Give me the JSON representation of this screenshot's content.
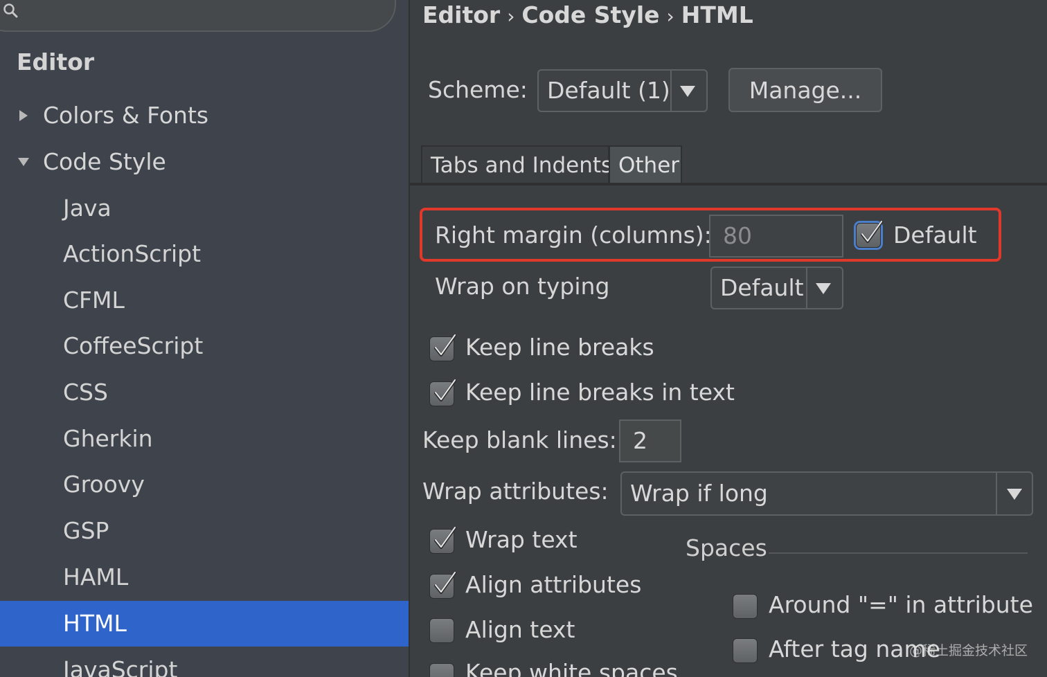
{
  "sidebar": {
    "heading": "Editor",
    "items": [
      {
        "label": "Colors & Fonts",
        "level": 1,
        "expanded": false
      },
      {
        "label": "Code Style",
        "level": 1,
        "expanded": true
      },
      {
        "label": "Java",
        "level": 2
      },
      {
        "label": "ActionScript",
        "level": 2
      },
      {
        "label": "CFML",
        "level": 2
      },
      {
        "label": "CoffeeScript",
        "level": 2
      },
      {
        "label": "CSS",
        "level": 2
      },
      {
        "label": "Gherkin",
        "level": 2
      },
      {
        "label": "Groovy",
        "level": 2
      },
      {
        "label": "GSP",
        "level": 2
      },
      {
        "label": "HAML",
        "level": 2
      },
      {
        "label": "HTML",
        "level": 2,
        "selected": true
      },
      {
        "label": "JavaScript",
        "level": 2
      }
    ]
  },
  "breadcrumb": {
    "part1": "Editor",
    "part2": "Code Style",
    "part3": "HTML",
    "separator": "›"
  },
  "scheme": {
    "label": "Scheme:",
    "value": "Default (1)",
    "manage_label": "Manage..."
  },
  "tabs": [
    {
      "label": "Tabs and Indents",
      "active": false
    },
    {
      "label": "Other",
      "active": true
    }
  ],
  "other": {
    "right_margin_label": "Right margin (columns):",
    "right_margin_value": "80",
    "default_checkbox_label": "Default",
    "default_checked": true,
    "wrap_on_typing_label": "Wrap on typing",
    "wrap_on_typing_value": "Default",
    "keep_line_breaks_label": "Keep line breaks",
    "keep_line_breaks_in_text_label": "Keep line breaks in text",
    "keep_blank_lines_label": "Keep blank lines:",
    "keep_blank_lines_value": "2",
    "wrap_attributes_label": "Wrap attributes:",
    "wrap_attributes_value": "Wrap if long",
    "wrap_text_label": "Wrap text",
    "align_attributes_label": "Align attributes",
    "align_text_label": "Align text",
    "keep_white_spaces_label": "Keep white spaces",
    "spaces_title": "Spaces",
    "around_eq_label": "Around \"=\" in attribute",
    "after_tag_name_label": "After tag name"
  },
  "watermark": "@稀土掘金技术社区",
  "colors": {
    "selection": "#2f65ca",
    "highlight_border": "#e0392b",
    "background": "#3c3f41"
  }
}
